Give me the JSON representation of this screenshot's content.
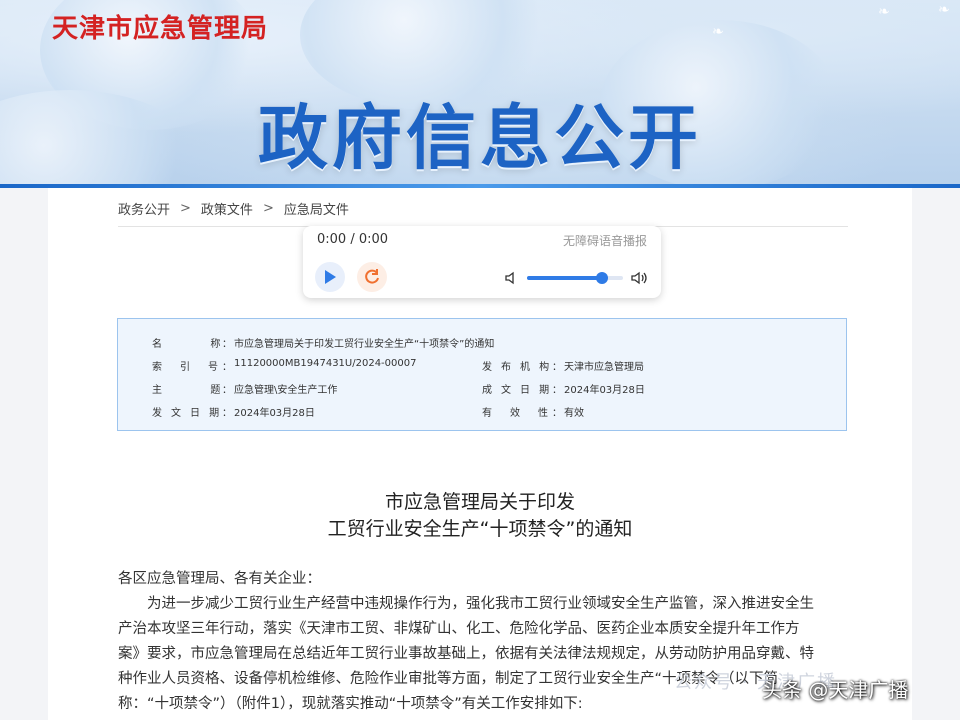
{
  "header": {
    "site_name": "天津市应急管理局",
    "section_title": "政府信息公开"
  },
  "breadcrumb": {
    "items": [
      "政务公开",
      "政策文件",
      "应急局文件"
    ],
    "separator": ">"
  },
  "audio_player": {
    "time": "0:00 / 0:00",
    "label": "无障碍语音播报",
    "volume_level": 0.78
  },
  "info": {
    "name_label": "名　　　　称：",
    "name_value": "市应急管理局关于印发工贸行业安全生产“十项禁令”的通知",
    "index_label": "索　引　号：",
    "index_value": "11120000MB1947431U/2024-00007",
    "issuer_label": "发 布 机 构：",
    "issuer_value": "天津市应急管理局",
    "topic_label": "主　　　　题：",
    "topic_value": "应急管理\\安全生产工作",
    "created_label": "成 文 日 期：",
    "created_value": "2024年03月28日",
    "issued_label": "发 文 日 期：",
    "issued_value": "2024年03月28日",
    "valid_label": "有　效　性：",
    "valid_value": "有效"
  },
  "document": {
    "title_line1": "市应急管理局关于印发",
    "title_line2": "工贸行业安全生产“十项禁令”的通知",
    "salutation": "各区应急管理局、各有关企业：",
    "line1": "为进一步减少工贸行业生产经营中违规操作行为，强化我市工贸行业领域安全生产监管，深入推进安全生",
    "line2": "产治本攻坚三年行动，落实《天津市工贸、非煤矿山、化工、危险化学品、医药企业本质安全提升年工作方",
    "line3": "案》要求，市应急管理局在总结近年工贸行业事故基础上，依据有关法律法规规定，从劳动防护用品穿戴、特",
    "line4": "种作业人员资格、设备停机检维修、危险作业审批等方面，制定了工贸行业安全生产“十项禁令（以下简",
    "line5": "称：“十项禁令”）（附件1），现就落实推动“十项禁令”有关工作安排如下:"
  },
  "overlay": {
    "watermark": "公众号 · 天津广播",
    "attribution": "头条 @天津广播"
  },
  "colors": {
    "site_red": "#d42222",
    "title_blue": "#1d63c4",
    "accent_blue": "#2f7be6",
    "info_bg": "#eef5fd",
    "info_border": "#9cc4ee"
  }
}
